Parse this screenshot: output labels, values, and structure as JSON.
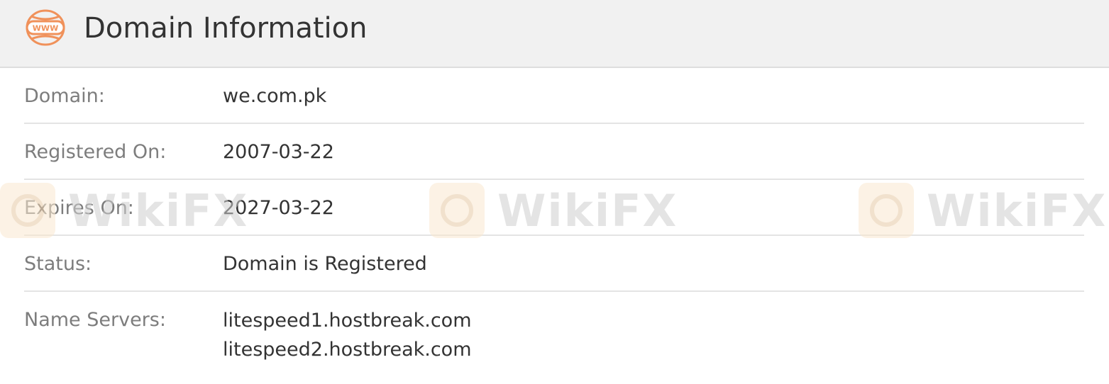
{
  "header": {
    "icon": "www-globe-icon",
    "icon_text": "WWW",
    "title": "Domain Information"
  },
  "rows": [
    {
      "label": "Domain:",
      "value": "we.com.pk"
    },
    {
      "label": "Registered On:",
      "value": "2007-03-22"
    },
    {
      "label": "Expires On:",
      "value": "2027-03-22"
    },
    {
      "label": "Status:",
      "value": "Domain is Registered"
    },
    {
      "label": "Name Servers:",
      "values": [
        "litespeed1.hostbreak.com",
        "litespeed2.hostbreak.com"
      ]
    }
  ],
  "watermark": {
    "text": "WikiFX",
    "logo": "wikifx-logo-icon"
  },
  "colors": {
    "accent": "#f0915a",
    "header_bg": "#f1f1f1",
    "label": "#7d7d7d",
    "value": "#333333",
    "divider": "#e4e4e4",
    "watermark_logo_bg": "#fbe9d0"
  }
}
